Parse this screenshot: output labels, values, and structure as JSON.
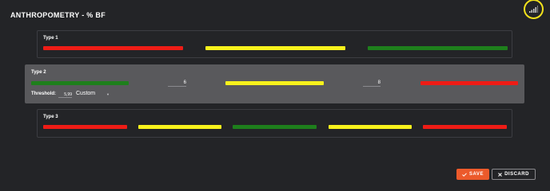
{
  "header": {
    "title": "ANTHROPOMETRY - % BF",
    "corner_icon": "signal-bars-icon"
  },
  "colors": {
    "red": "#ee1c16",
    "yellow": "#f7f21c",
    "green": "#1e7f1c",
    "accent": "#ec5a2b"
  },
  "types": [
    {
      "label": "Type 1",
      "zones": [
        "red",
        "yellow",
        "green"
      ]
    },
    {
      "label": "Type 2",
      "zones": [
        "green",
        "yellow",
        "red"
      ],
      "boundary_1": "6",
      "boundary_2": "8",
      "threshold_label": "Threshold:",
      "threshold_value": "5,99",
      "threshold_mode": "Custom"
    },
    {
      "label": "Type 3",
      "zones": [
        "red",
        "yellow",
        "green",
        "yellow",
        "red"
      ]
    }
  ],
  "actions": {
    "save_label": "SAVE",
    "save_icon": "check-icon",
    "discard_label": "DISCARD",
    "discard_icon": "close-icon"
  }
}
